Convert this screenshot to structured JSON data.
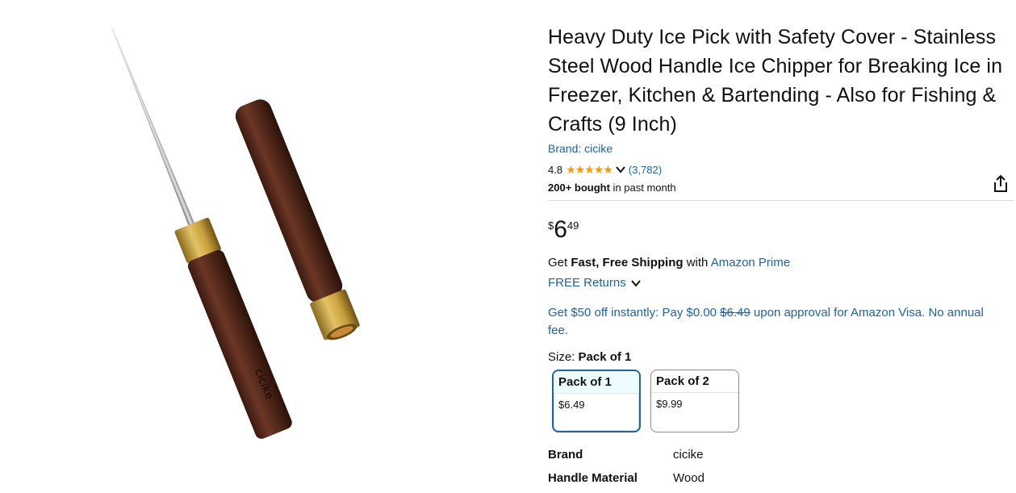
{
  "product": {
    "image_alt": "Ice pick with wooden handle and brass ferrule beside wooden safety cover",
    "image_logo_text": "cicike",
    "title": "Heavy Duty Ice Pick with Safety Cover - Stainless Steel Wood Handle Ice Chipper for Breaking Ice in Freezer, Kitchen & Bartending - Also for Fishing & Crafts (9 Inch)",
    "brand_link": "Brand: cicike",
    "rating": "4.8",
    "stars": "★★★★★",
    "rating_count": "(3,782)",
    "bought_bold": "200+ bought",
    "bought_rest": " in past month"
  },
  "price": {
    "symbol": "$",
    "whole": "6",
    "fraction": "49"
  },
  "shipping": {
    "prefix": "Get ",
    "bold": "Fast, Free Shipping",
    "middle": " with ",
    "link": "Amazon Prime",
    "returns": "FREE Returns"
  },
  "promo": {
    "part1": "Get $50 off instantly: Pay $0.00 ",
    "strike": "$6.49",
    "part2": " upon approval for Amazon Visa. No annual fee."
  },
  "size": {
    "label": "Size: ",
    "selected": "Pack of 1",
    "options": [
      {
        "name": "Pack of 1",
        "price": "$6.49"
      },
      {
        "name": "Pack of 2",
        "price": "$9.99"
      }
    ]
  },
  "specs": [
    {
      "key": "Brand",
      "value": "cicike"
    },
    {
      "key": "Handle Material",
      "value": "Wood"
    }
  ],
  "colors": {
    "link": "#2162a1",
    "star": "#ff9900",
    "selected_border": "#2162a1"
  },
  "icons": {
    "share": "share-icon",
    "chevron": "chevron-down-icon"
  }
}
